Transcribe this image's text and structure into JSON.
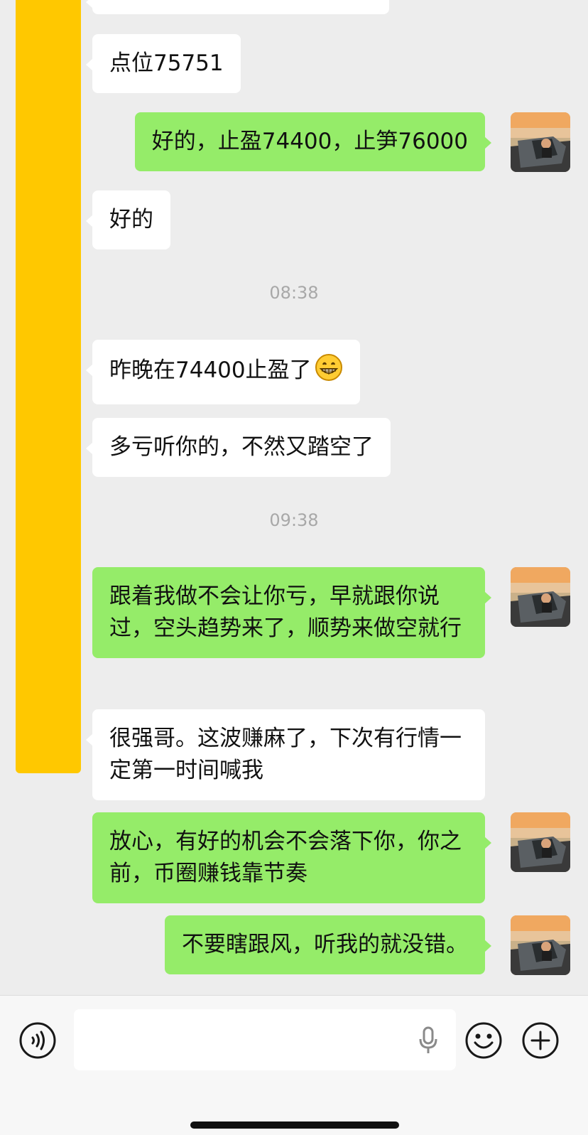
{
  "chat": {
    "messages": [
      {
        "direction": "in",
        "text": "点位75751"
      },
      {
        "direction": "out",
        "text": "好的，止盈74400，止笋76000"
      },
      {
        "direction": "in",
        "text": "好的"
      },
      {
        "type": "time",
        "text": "08:38"
      },
      {
        "direction": "in",
        "text": "昨晚在74400止盈了",
        "emoji": "grinning-face"
      },
      {
        "direction": "in",
        "text": "多亏听你的，不然又踏空了"
      },
      {
        "type": "time",
        "text": "09:38"
      },
      {
        "direction": "out",
        "text": "跟着我做不会让你亏，早就跟你说过，空头趋势来了，顺势来做空就行"
      },
      {
        "direction": "in",
        "text": "很强哥。这波赚麻了，下次有行情一定第一时间喊我"
      },
      {
        "direction": "out",
        "text": "放心，有好的机会不会落下你，你之前，币圈赚钱靠节奏"
      },
      {
        "direction": "out",
        "text": "不要瞎跟风，听我的就没错。"
      }
    ]
  },
  "input_bar": {
    "voice_icon": "voice-wave-icon",
    "mic_icon": "microphone-icon",
    "emoji_icon": "smiley-icon",
    "add_icon": "plus-icon"
  },
  "colors": {
    "background": "#ededed",
    "outgoing_bubble": "#95ec69",
    "incoming_bubble": "#ffffff",
    "redaction": "#ffc800",
    "timestamp": "#a8a8a8"
  }
}
